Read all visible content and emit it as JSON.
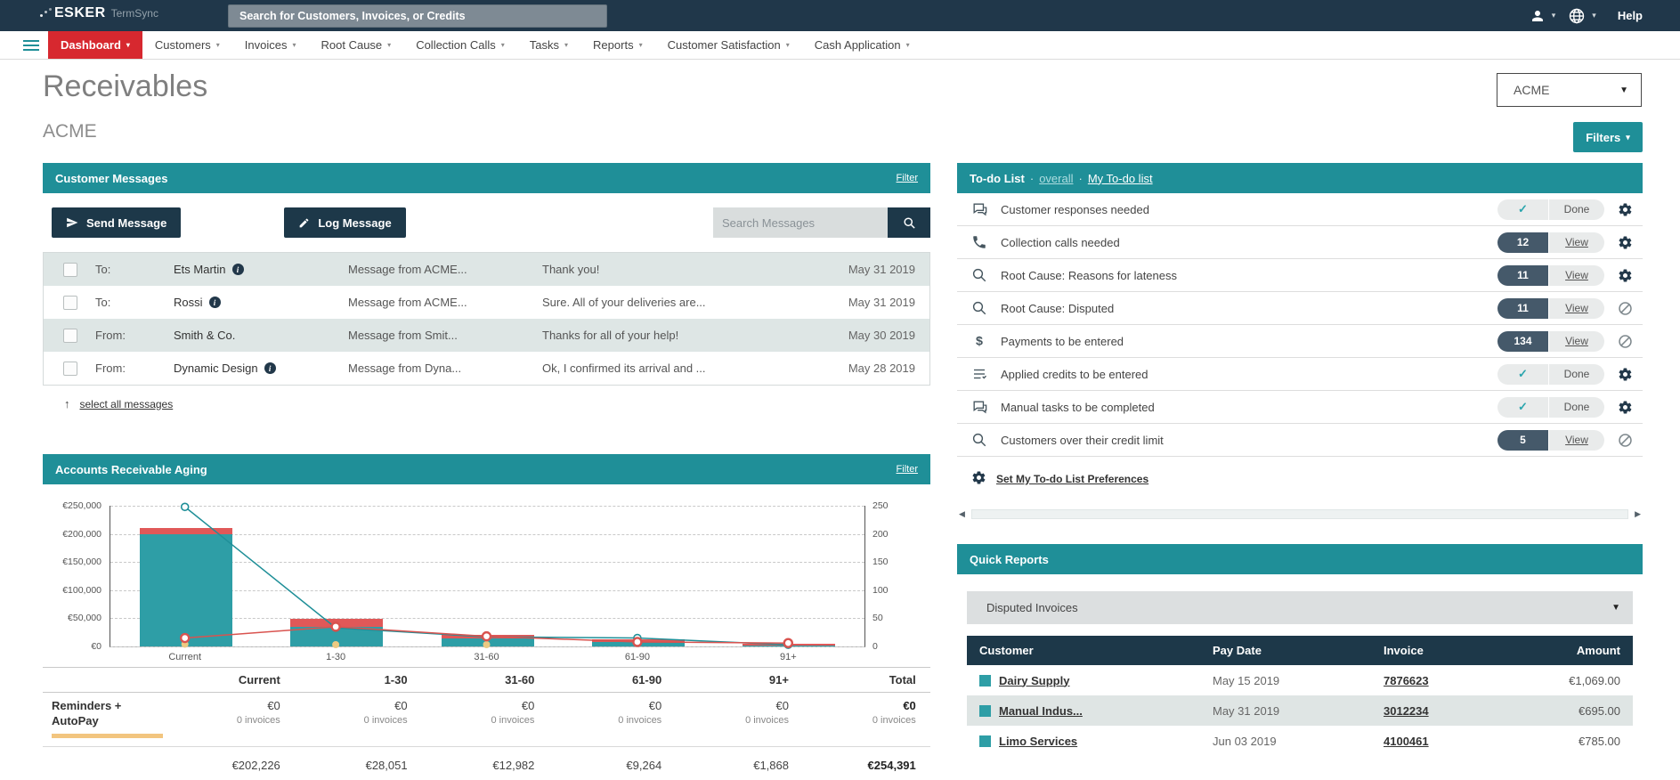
{
  "topbar": {
    "logo_primary": "ESKER",
    "logo_secondary": "TermSync",
    "search_placeholder": "Search for Customers, Invoices, or Credits",
    "help_label": "Help"
  },
  "nav": {
    "items": [
      {
        "label": "Dashboard",
        "active": true
      },
      {
        "label": "Customers",
        "active": false
      },
      {
        "label": "Invoices",
        "active": false
      },
      {
        "label": "Root Cause",
        "active": false
      },
      {
        "label": "Collection Calls",
        "active": false
      },
      {
        "label": "Tasks",
        "active": false
      },
      {
        "label": "Reports",
        "active": false
      },
      {
        "label": "Customer Satisfaction",
        "active": false
      },
      {
        "label": "Cash Application",
        "active": false
      }
    ]
  },
  "page": {
    "title": "Receivables",
    "subtitle": "ACME",
    "company_selector_value": "ACME",
    "filters_button_label": "Filters"
  },
  "customer_messages": {
    "title": "Customer Messages",
    "filter_link": "Filter",
    "send_button": "Send Message",
    "log_button": "Log Message",
    "search_placeholder": "Search Messages",
    "select_all_link": "select all messages",
    "rows": [
      {
        "direction": "To:",
        "name": "Ets Martin",
        "has_info": true,
        "subject": "Message from ACME...",
        "preview": "Thank you!",
        "date": "May 31 2019"
      },
      {
        "direction": "To:",
        "name": "Rossi",
        "has_info": true,
        "subject": "Message from ACME...",
        "preview": "Sure. All of your deliveries are...",
        "date": "May 31 2019"
      },
      {
        "direction": "From:",
        "name": "Smith & Co.",
        "has_info": false,
        "subject": "Message from Smit...",
        "preview": "Thanks for all of your help!",
        "date": "May 30 2019"
      },
      {
        "direction": "From:",
        "name": "Dynamic Design",
        "has_info": true,
        "subject": "Message from Dyna...",
        "preview": "Ok, I confirmed its arrival and ...",
        "date": "May 28 2019"
      }
    ]
  },
  "todo": {
    "title": "To-do List",
    "separator": "·",
    "overall_link": "overall",
    "my_list_link": "My To-do list",
    "preferences_link": "Set My To-do List Preferences",
    "items": [
      {
        "icon": "chat",
        "label": "Customer responses needed",
        "count": null,
        "action": "Done",
        "end_icon": "gear"
      },
      {
        "icon": "phone",
        "label": "Collection calls needed",
        "count": "12",
        "action": "View",
        "end_icon": "gear"
      },
      {
        "icon": "magnifier",
        "label": "Root Cause: Reasons for lateness",
        "count": "11",
        "action": "View",
        "end_icon": "gear"
      },
      {
        "icon": "magnifier",
        "label": "Root Cause: Disputed",
        "count": "11",
        "action": "View",
        "end_icon": "no-entry"
      },
      {
        "icon": "dollar",
        "label": "Payments to be entered",
        "count": "134",
        "action": "View",
        "end_icon": "no-entry"
      },
      {
        "icon": "credits",
        "label": "Applied credits to be entered",
        "count": null,
        "action": "Done",
        "end_icon": "gear"
      },
      {
        "icon": "chat",
        "label": "Manual tasks to be completed",
        "count": null,
        "action": "Done",
        "end_icon": "gear"
      },
      {
        "icon": "magnifier",
        "label": "Customers over their credit limit",
        "count": "5",
        "action": "View",
        "end_icon": "no-entry"
      }
    ]
  },
  "ar_aging": {
    "title": "Accounts Receivable Aging",
    "filter_link": "Filter",
    "table": {
      "columns": [
        "Current",
        "1-30",
        "31-60",
        "61-90",
        "91+",
        "Total"
      ],
      "rows": [
        {
          "label": "Reminders + AutoPay",
          "amounts": [
            "€0",
            "€0",
            "€0",
            "€0",
            "€0",
            "€0"
          ],
          "invoices": [
            "0 invoices",
            "0 invoices",
            "0 invoices",
            "0 invoices",
            "0 invoices",
            "0 invoices"
          ]
        },
        {
          "label": "",
          "amounts": [
            "€202,226",
            "€28,051",
            "€12,982",
            "€9,264",
            "€1,868",
            "€254,391"
          ],
          "invoices": []
        }
      ]
    }
  },
  "chart_data": {
    "type": "bar",
    "subtype": "stacked-bar-with-lines",
    "title": "Accounts Receivable Aging",
    "categories": [
      "Current",
      "1-30",
      "31-60",
      "61-90",
      "91+"
    ],
    "series": [
      {
        "name": "current-amount",
        "type": "bar",
        "color": "#2e9ea6",
        "axis": "left",
        "values": [
          200000,
          35000,
          15000,
          8000,
          1000
        ]
      },
      {
        "name": "overdue-amount",
        "type": "bar",
        "color": "#e05858",
        "axis": "left",
        "values": [
          10000,
          14000,
          6000,
          5000,
          4000
        ]
      },
      {
        "name": "invoice-count",
        "type": "line",
        "color": "#1f8f98",
        "axis": "right",
        "values": [
          248,
          33,
          17,
          15,
          3
        ]
      },
      {
        "name": "late-count",
        "type": "line",
        "color": "#d9534f",
        "axis": "right",
        "values": [
          15,
          35,
          18,
          8,
          6
        ]
      },
      {
        "name": "autopay-markers",
        "type": "point",
        "color": "#ecca82",
        "axis": "right",
        "values": [
          4,
          3,
          2,
          null,
          null
        ]
      }
    ],
    "left_axis": {
      "ticks": [
        "€250,000",
        "€200,000",
        "€150,000",
        "€100,000",
        "€50,000",
        "€0"
      ],
      "max": 250000,
      "min": 0
    },
    "right_axis": {
      "ticks": [
        "250",
        "200",
        "150",
        "100",
        "50",
        "0"
      ],
      "max": 250,
      "min": 0
    },
    "grid": "horizontal-dashed",
    "legend": "none"
  },
  "quick_reports": {
    "title": "Quick Reports",
    "selector_value": "Disputed Invoices",
    "table": {
      "columns": [
        "Customer",
        "Pay Date",
        "Invoice",
        "Amount"
      ],
      "rows": [
        {
          "customer": "Dairy Supply",
          "pay_date": "May 15 2019",
          "invoice": "7876623",
          "amount": "€1,069.00"
        },
        {
          "customer": "Manual Indus...",
          "pay_date": "May 31 2019",
          "invoice": "3012234",
          "amount": "€695.00"
        },
        {
          "customer": "Limo Services",
          "pay_date": "Jun 03 2019",
          "invoice": "4100461",
          "amount": "€785.00"
        }
      ]
    }
  },
  "colors": {
    "topbar_bg": "#20374a",
    "nav_active_red": "#d7282f",
    "teal_accent": "#1f8f98",
    "navy_button": "#1d3849",
    "pill_dark": "#45596a",
    "row_alt": "#dee6e5",
    "chart_teal": "#2e9ea6",
    "chart_red": "#e05858",
    "check_teal": "#2aa5ad",
    "orange_bar": "#f2c57f"
  }
}
